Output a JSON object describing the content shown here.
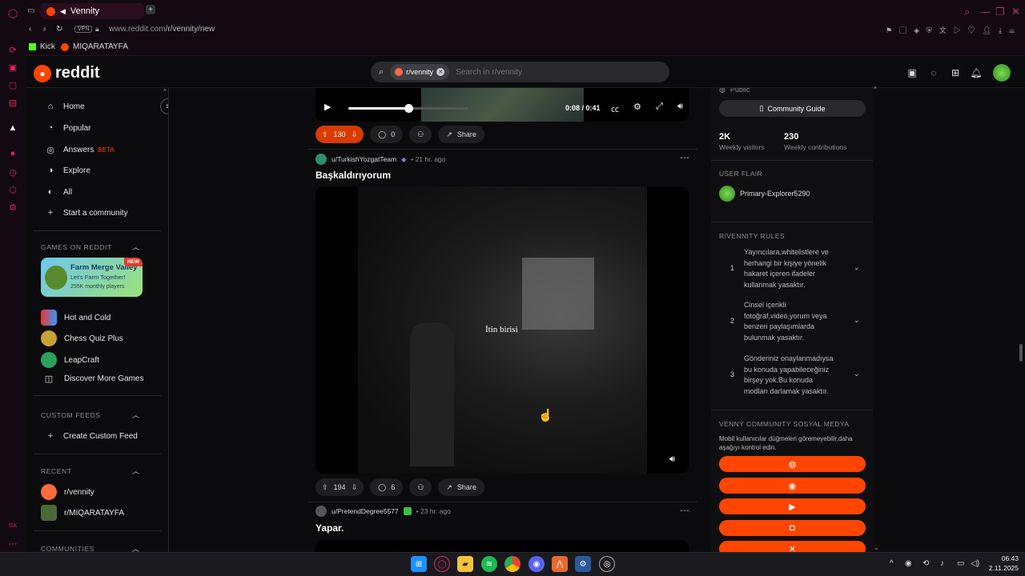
{
  "browser": {
    "tab_title": "Vennity",
    "url_host": "www.reddit.com",
    "url_path": "/r/vennity/new",
    "vpn_label": "VPN",
    "bookmarks": [
      "Kick",
      "MIQARATAYFA"
    ],
    "rail_label": "GX"
  },
  "header": {
    "logo_text": "reddit",
    "search_chip": "r/vennity",
    "search_placeholder": "Search in r/vennity"
  },
  "sidebar": {
    "nav": [
      {
        "label": "Home",
        "icon": "home-icon"
      },
      {
        "label": "Popular",
        "icon": "popular-icon"
      },
      {
        "label": "Answers",
        "icon": "answers-icon",
        "badge": "BETA"
      },
      {
        "label": "Explore",
        "icon": "explore-icon"
      },
      {
        "label": "All",
        "icon": "all-icon"
      },
      {
        "label": "Start a community",
        "icon": "plus-icon"
      }
    ],
    "games_header": "GAMES ON REDDIT",
    "featured_game": {
      "title": "Farm Merge Valley",
      "subtitle": "Let's Farm Together!",
      "meta": "255K monthly players",
      "badge": "NEW"
    },
    "games": [
      "Hot and Cold",
      "Chess Quiz Plus",
      "LeapCraft",
      "Discover More Games"
    ],
    "custom_feeds_header": "CUSTOM FEEDS",
    "create_feed": "Create Custom Feed",
    "recent_header": "RECENT",
    "recent": [
      "r/vennity",
      "r/MIQARATAYFA"
    ],
    "communities_header": "COMMUNITIES"
  },
  "feed": {
    "video1": {
      "time": "0:08 / 0:41",
      "progress": 0.5
    },
    "post0": {
      "votes": "130",
      "comments": "0",
      "share": "Share"
    },
    "post1": {
      "author": "u/TurkishYozgatTeam",
      "ago": "• 21 hr. ago",
      "title": "Başkaldırıyorum",
      "caption": "İtin birisi",
      "votes": "194",
      "comments": "6",
      "share": "Share"
    },
    "post2": {
      "author": "u/PretendDegree5577",
      "ago": "• 23 hr. ago",
      "title": "Yapar."
    }
  },
  "right": {
    "visibility": "Public",
    "guide_label": "Community Guide",
    "stats": [
      {
        "value": "2K",
        "label": "Weekly visitors"
      },
      {
        "value": "230",
        "label": "Weekly contributions"
      }
    ],
    "user_flair_header": "USER FLAIR",
    "flair_name": "Primary-Explorer5290",
    "rules_header": "R/VENNITY RULES",
    "rules": [
      {
        "n": "1",
        "text": "Yayıncılara,whitelistlere ve herhangi bir kişiye yönelik hakaret içeren ifadeler kullanmak yasaktır."
      },
      {
        "n": "2",
        "text": "Cinsel içerikli fotoğraf,video,yorum veya benzeri paylaşımlarda bulunmak yasaktır."
      },
      {
        "n": "3",
        "text": "Gönderiniz onaylanmadıysa bu konuda yapabileceğiniz birşey yok.Bu konuda modları darlamak yasaktır."
      }
    ],
    "social_header": "VENNY COMMUNITY SOSYAL MEDYA",
    "social_note": "Mobil kullanıcılar düğmeleri göremeyebilir,daha aşağıyı kontrol edin."
  },
  "taskbar": {
    "time": "06:43",
    "date": "2.11.2025"
  },
  "colors": {
    "accent": "#ff4500",
    "upvote_active": "#d93a00",
    "opera": "#e0245e"
  }
}
